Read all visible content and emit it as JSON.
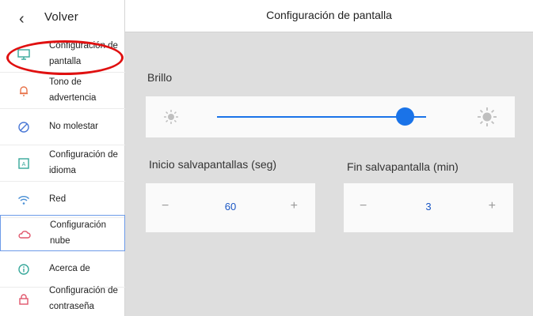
{
  "header": {
    "title": "Configuración de pantalla"
  },
  "back": {
    "label": "Volver"
  },
  "sidebar": {
    "items": [
      {
        "label": "Configuración de pantalla",
        "icon": "monitor-icon"
      },
      {
        "label": "Tono de advertencia",
        "icon": "bell-icon"
      },
      {
        "label": "No molestar",
        "icon": "do-not-disturb-icon"
      },
      {
        "label": "Configuración de idioma",
        "icon": "language-icon"
      },
      {
        "label": "Red",
        "icon": "wifi-icon"
      },
      {
        "label": "Configuración nube",
        "icon": "cloud-icon"
      },
      {
        "label": "Acerca de",
        "icon": "info-icon"
      },
      {
        "label": "Configuración de contraseña",
        "icon": "lock-icon"
      }
    ],
    "selected": "Configuración nube"
  },
  "brightness": {
    "label": "Brillo",
    "level": 0.9
  },
  "screensaver_start": {
    "label": "Inicio salvapantallas (seg)",
    "minus": "−",
    "value": "60",
    "plus": "+"
  },
  "screensaver_end": {
    "label": "Fin salvapantalla (min)",
    "minus": "−",
    "value": "3",
    "plus": "+"
  },
  "colors": {
    "accent": "#1a73e8",
    "icon": "#36a79a",
    "annotation": "#e01010",
    "panel": "#dedede"
  }
}
